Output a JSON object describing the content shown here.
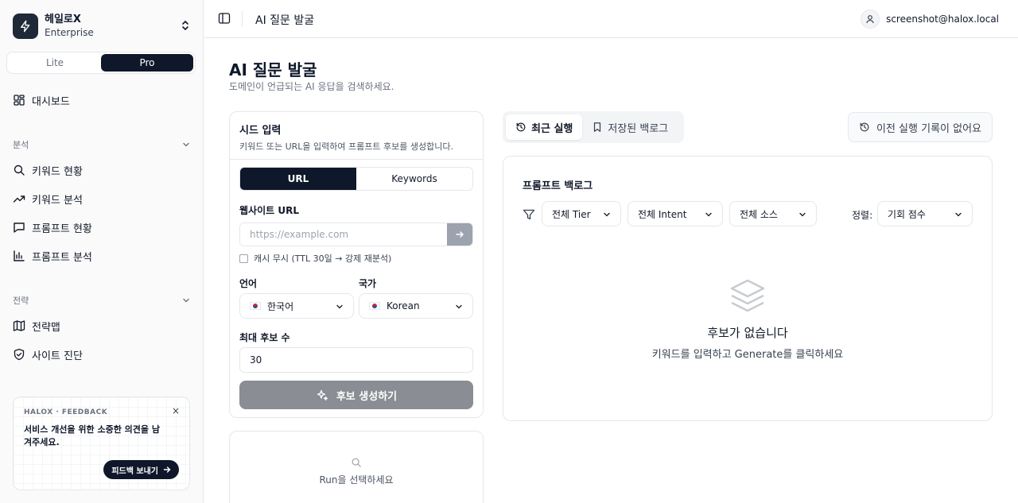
{
  "org": {
    "name": "헤일로X",
    "plan": "Enterprise"
  },
  "plan_toggle": {
    "lite": "Lite",
    "pro": "Pro",
    "selected": "Pro"
  },
  "nav": {
    "dashboard": "대시보드",
    "analysis_group": "분석",
    "keyword_status": "키워드 현황",
    "keyword_analysis": "키워드 분석",
    "prompt_status": "프롬프트 현황",
    "prompt_analysis": "프롬프트 분석",
    "strategy_group": "전략",
    "strategy_map": "전략맵",
    "site_diagnosis": "사이트 진단"
  },
  "feedback": {
    "tag": "HALOX · FEEDBACK",
    "text": "서비스 개선을 위한 소중한 의견을 남겨주세요.",
    "button": "피드백 보내기",
    "close": "×"
  },
  "header": {
    "title": "AI 질문 발굴",
    "user_email": "screenshot@halox.local"
  },
  "page": {
    "title": "AI 질문 발굴",
    "subtitle": "도메인이 언급되는 AI 응답을 검색하세요."
  },
  "seed": {
    "title": "시드 입력",
    "desc": "키워드 또는 URL을 입력하여 프롬프트 후보를 생성합니다.",
    "mode_url": "URL",
    "mode_keywords": "Keywords",
    "url_label": "웹사이트 URL",
    "url_placeholder": "https://example.com",
    "url_value": "",
    "cache_label": "캐시 무시 (TTL 30일 → 강제 재분석)",
    "language_label": "언어",
    "language_value": "한국어",
    "country_label": "국가",
    "country_value": "Korean",
    "max_label": "최대 후보 수",
    "max_value": "30",
    "generate": "후보 생성하기"
  },
  "run": {
    "empty": "Run을 선택하세요"
  },
  "tabs": {
    "recent": "최근 실행",
    "saved": "저장된 백로그"
  },
  "history_button": "이전 실행 기록이 없어요",
  "backlog": {
    "title": "프롬프트 백로그",
    "tier": "전체 Tier",
    "intent": "전체 Intent",
    "source": "전체 소스",
    "sort_label": "정렬:",
    "sort_value": "기회 점수",
    "empty_title": "후보가 없습니다",
    "empty_sub": "키워드를 입력하고 Generate를 클릭하세요"
  }
}
